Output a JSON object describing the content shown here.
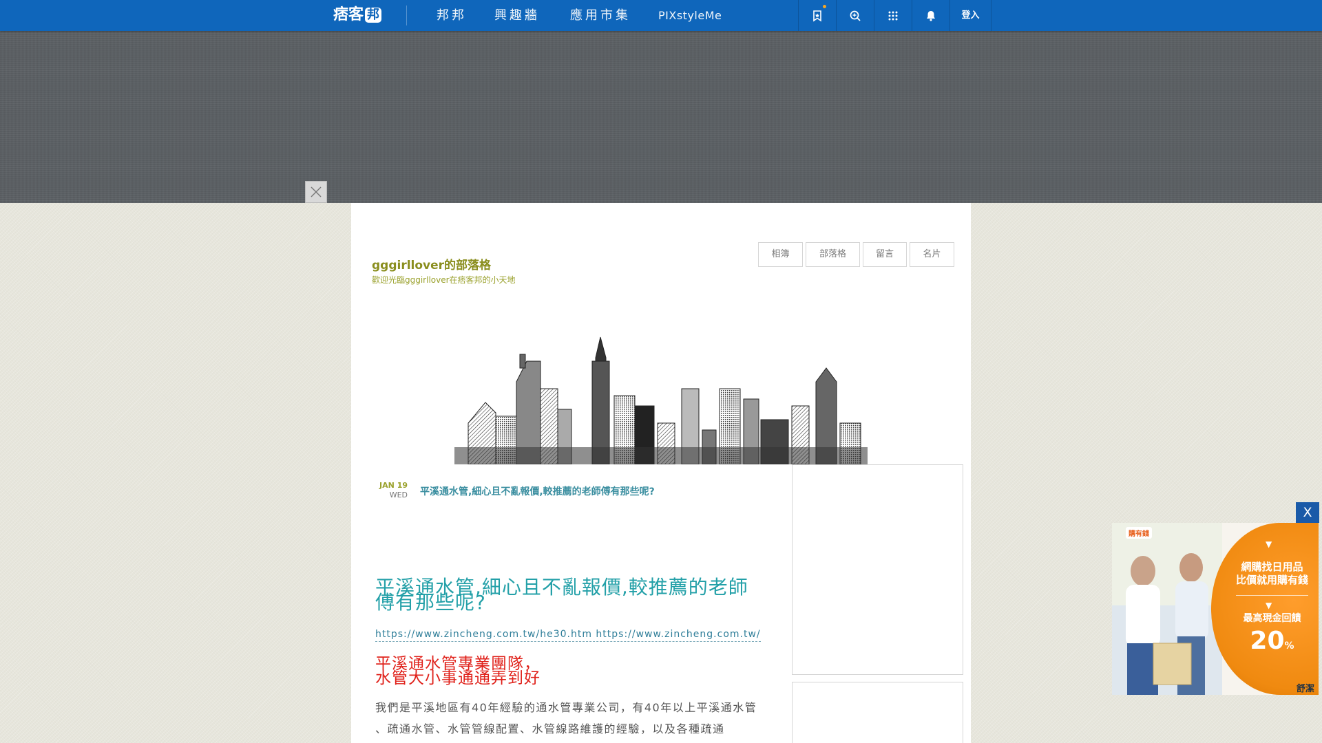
{
  "topbar": {
    "logo_text": "痞客",
    "logo_bubble": "邦",
    "nav": [
      "邦邦",
      "興趣牆",
      "應用市集",
      "PIXstyleMe"
    ],
    "login_label": "登入",
    "icons": [
      "bookmark-icon",
      "search-icon",
      "apps-grid-icon",
      "bell-icon"
    ],
    "accent_color": "#0f66bb"
  },
  "blog": {
    "title": "gggirllover的部落格",
    "subtitle": "歡迎光臨gggirllover在痞客邦的小天地",
    "tabs": [
      "相簿",
      "部落格",
      "留言",
      "名片"
    ]
  },
  "post_preview": {
    "month_day": "JAN 19",
    "weekday": "WED",
    "title": "平溪通水管,細心且不亂報價,較推薦的老師傅有那些呢?"
  },
  "article": {
    "title": "平溪通水管,細心且不亂報價,較推薦的老師傅有那些呢?",
    "link1": "https://www.zincheng.com.tw/he30.htm",
    "link2": "https://www.zincheng.com.tw/",
    "red_heading_line1": "平溪通水管專業團隊，",
    "red_heading_line2": "水管大小事通通弄到好",
    "body": "我們是平溪地區有40年經驗的通水管專業公司，有40年以上平溪通水管 、疏通水管、水管管線配置、水管線路維護的經驗，以及各種疏通"
  },
  "float_ad": {
    "close_label": "X",
    "logo_chip": "購有錢",
    "line1": "網購找日用品",
    "line1b": "比價就用購有錢",
    "line2": "最高現金回饋",
    "percent": "20",
    "percent_sign": "%",
    "brand": "舒潔"
  }
}
